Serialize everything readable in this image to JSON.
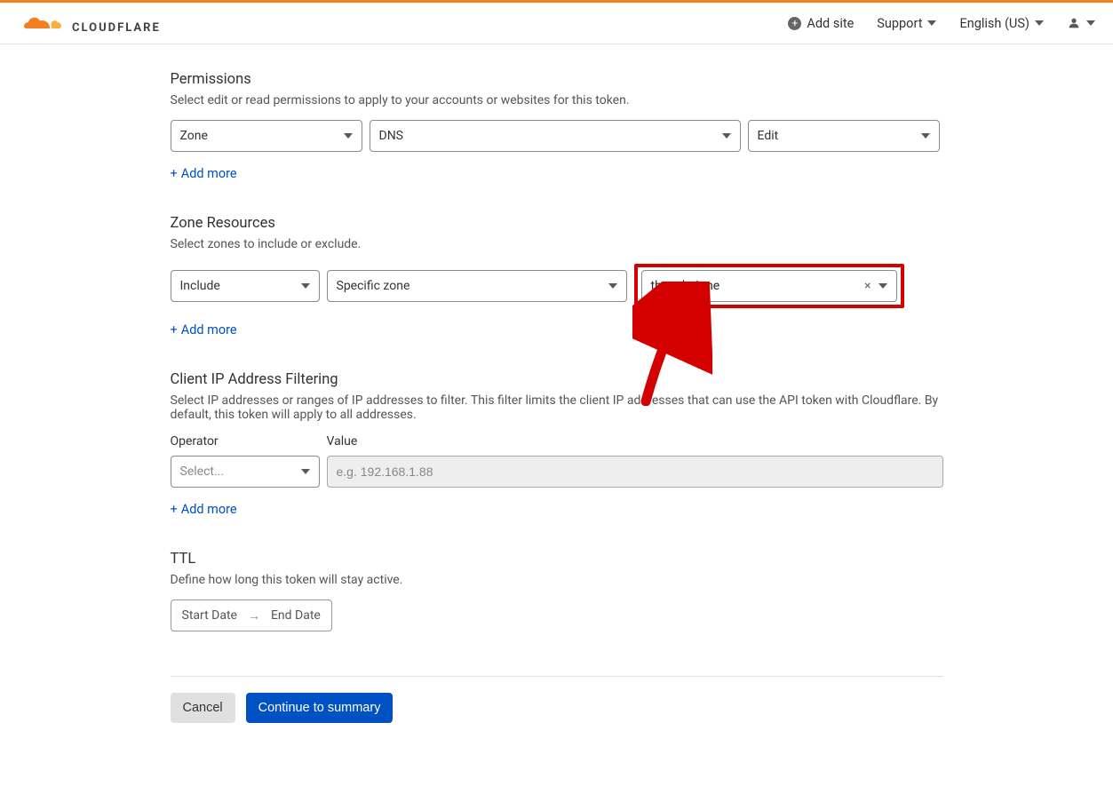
{
  "header": {
    "logo_text": "CLOUDFLARE",
    "add_site": "Add site",
    "support": "Support",
    "language": "English (US)"
  },
  "permissions": {
    "title": "Permissions",
    "desc": "Select edit or read permissions to apply to your accounts or websites for this token.",
    "scope": "Zone",
    "resource": "DNS",
    "action": "Edit",
    "add_more": "Add more"
  },
  "zone_resources": {
    "title": "Zone Resources",
    "desc": "Select zones to include or exclude.",
    "mode": "Include",
    "type": "Specific zone",
    "zone": "thuanbui.me",
    "add_more": "Add more"
  },
  "ip_filter": {
    "title": "Client IP Address Filtering",
    "desc": "Select IP addresses or ranges of IP addresses to filter. This filter limits the client IP addresses that can use the API token with Cloudflare. By default, this token will apply to all addresses.",
    "operator_label": "Operator",
    "operator_placeholder": "Select...",
    "value_label": "Value",
    "value_placeholder": "e.g. 192.168.1.88",
    "add_more": "Add more"
  },
  "ttl": {
    "title": "TTL",
    "desc": "Define how long this token will stay active.",
    "start": "Start Date",
    "end": "End Date"
  },
  "footer": {
    "cancel": "Cancel",
    "continue": "Continue to summary"
  }
}
